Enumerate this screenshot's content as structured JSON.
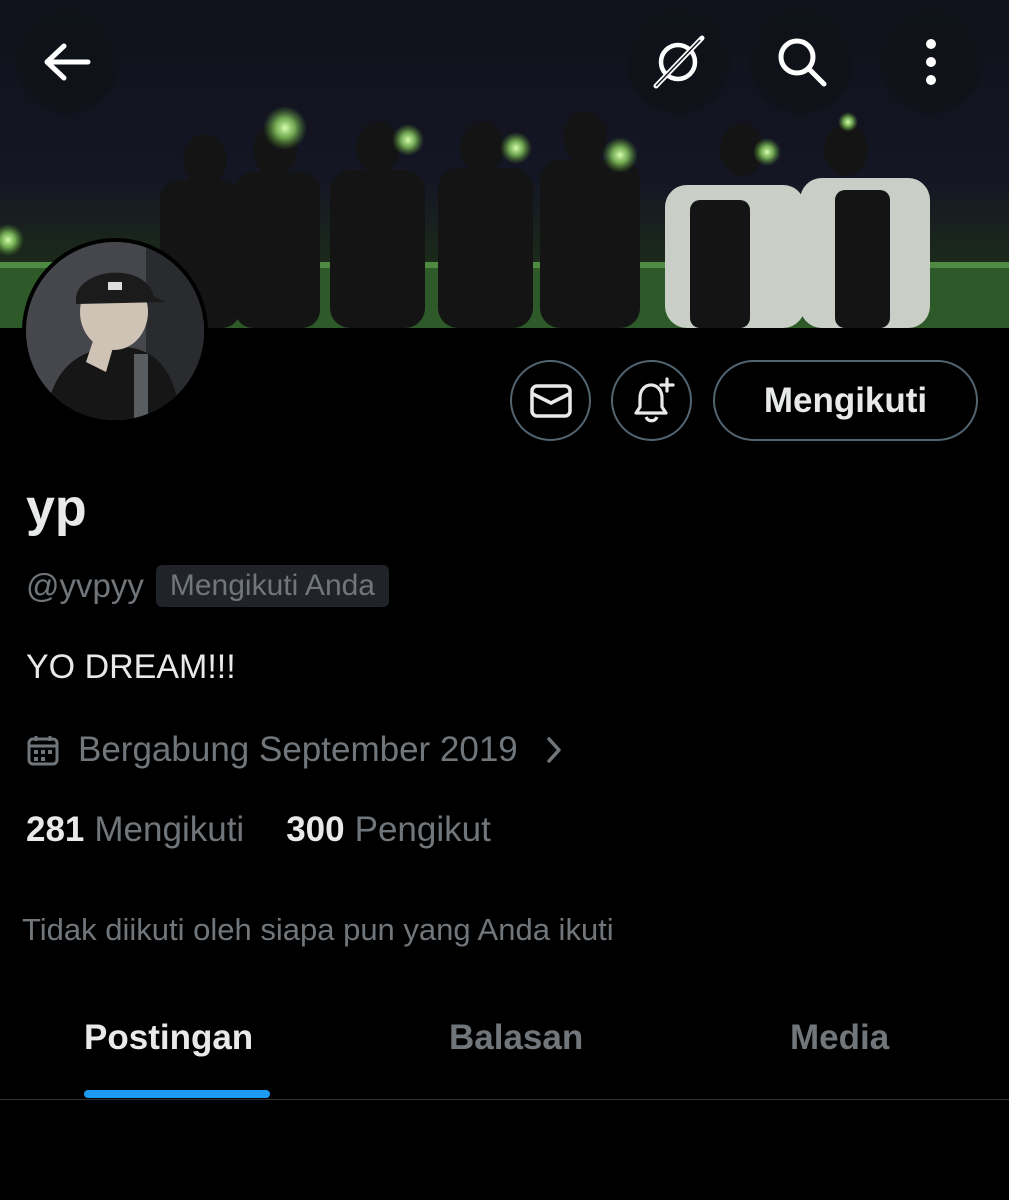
{
  "header": {
    "back_icon": "arrow-left-icon",
    "grok_icon": "grok-icon",
    "search_icon": "search-icon",
    "more_icon": "more-vertical-icon"
  },
  "profile": {
    "display_name": "yp",
    "handle": "@yvpyy",
    "follows_you_badge": "Mengikuti Anda",
    "bio": "YO DREAM!!!",
    "joined": "Bergabung September 2019",
    "following_count": "281",
    "following_label": "Mengikuti",
    "followers_count": "300",
    "followers_label": "Pengikut",
    "mutual_text": "Tidak diikuti oleh siapa pun yang Anda ikuti"
  },
  "actions": {
    "message_icon": "envelope-icon",
    "notify_icon": "bell-plus-icon",
    "follow_label": "Mengikuti"
  },
  "tabs": [
    {
      "label": "Postingan",
      "active": true
    },
    {
      "label": "Balasan",
      "active": false
    },
    {
      "label": "Media",
      "active": false
    }
  ],
  "colors": {
    "background": "#000000",
    "text_primary": "#e7e9ea",
    "text_secondary": "#71767b",
    "accent": "#1d9bf0",
    "border": "#536471"
  }
}
